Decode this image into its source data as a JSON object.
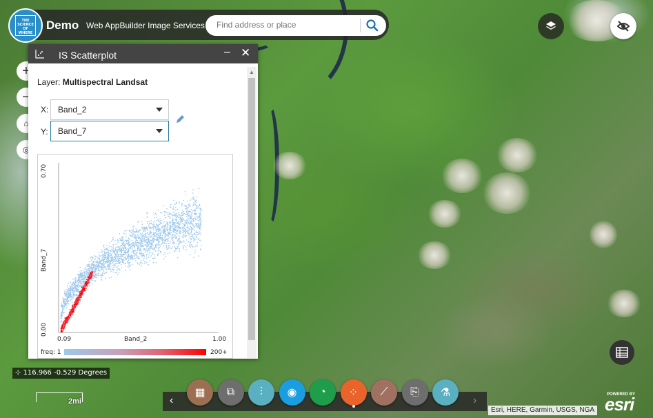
{
  "app": {
    "logo_text": "THE SCIENCE OF WHERE",
    "title": "Demo",
    "subtitle": "Web AppBuilder Image Services"
  },
  "search": {
    "placeholder": "Find address or place"
  },
  "map_controls": {
    "zoom_in": "+",
    "zoom_out": "−"
  },
  "widget": {
    "title": "IS Scatterplot",
    "minimize": "–",
    "close": "✕",
    "layer_label": "Layer:",
    "layer_name": "Multispectral Landsat",
    "x_label": "X:",
    "y_label": "Y:",
    "x_band": "Band_2",
    "y_band": "Band_7"
  },
  "chart_data": {
    "type": "scatter",
    "title": "",
    "xlabel": "Band_2",
    "ylabel": "Band_7",
    "xlim": [
      0.09,
      1.0
    ],
    "ylim": [
      0.0,
      0.7
    ],
    "x_ticks": [
      "0.09",
      "1.00"
    ],
    "y_ticks": [
      "0.00",
      "0.70"
    ],
    "legend": {
      "label": "freq:",
      "min": "1",
      "max": "200+",
      "color_low": "#9ec8ec",
      "color_high": "#ff0000"
    },
    "density_clusters": [
      {
        "name": "low-frequency points",
        "color": "#9ec8ec",
        "x_range": [
          0.09,
          1.0
        ],
        "y_range": [
          0.0,
          0.55
        ]
      },
      {
        "name": "high-frequency core",
        "color": "#ff0000",
        "x_range": [
          0.09,
          0.3
        ],
        "y_range": [
          0.0,
          0.28
        ]
      }
    ]
  },
  "status": {
    "coordinates": "116.966 -0.529 Degrees",
    "scale": "2mi"
  },
  "toolbar": {
    "prev": "‹",
    "next": "›",
    "buttons": [
      {
        "name": "image-tool-1",
        "color": "#9c6e52"
      },
      {
        "name": "image-tool-2",
        "color": "#6e6e6e"
      },
      {
        "name": "image-tool-3",
        "color": "#5ab0c0"
      },
      {
        "name": "image-tool-4",
        "color": "#1a9ee0"
      },
      {
        "name": "image-tool-5",
        "color": "#1e9e4a"
      },
      {
        "name": "scatterplot",
        "color": "#e8642a"
      },
      {
        "name": "image-tool-7",
        "color": "#a07060"
      },
      {
        "name": "image-tool-8",
        "color": "#6e6e6e"
      },
      {
        "name": "image-tool-9",
        "color": "#5ab0c0"
      }
    ]
  },
  "attribution": "Esri, HERE, Garmin, USGS, NGA",
  "esri": {
    "powered_by": "POWERED BY",
    "logo": "esri"
  }
}
